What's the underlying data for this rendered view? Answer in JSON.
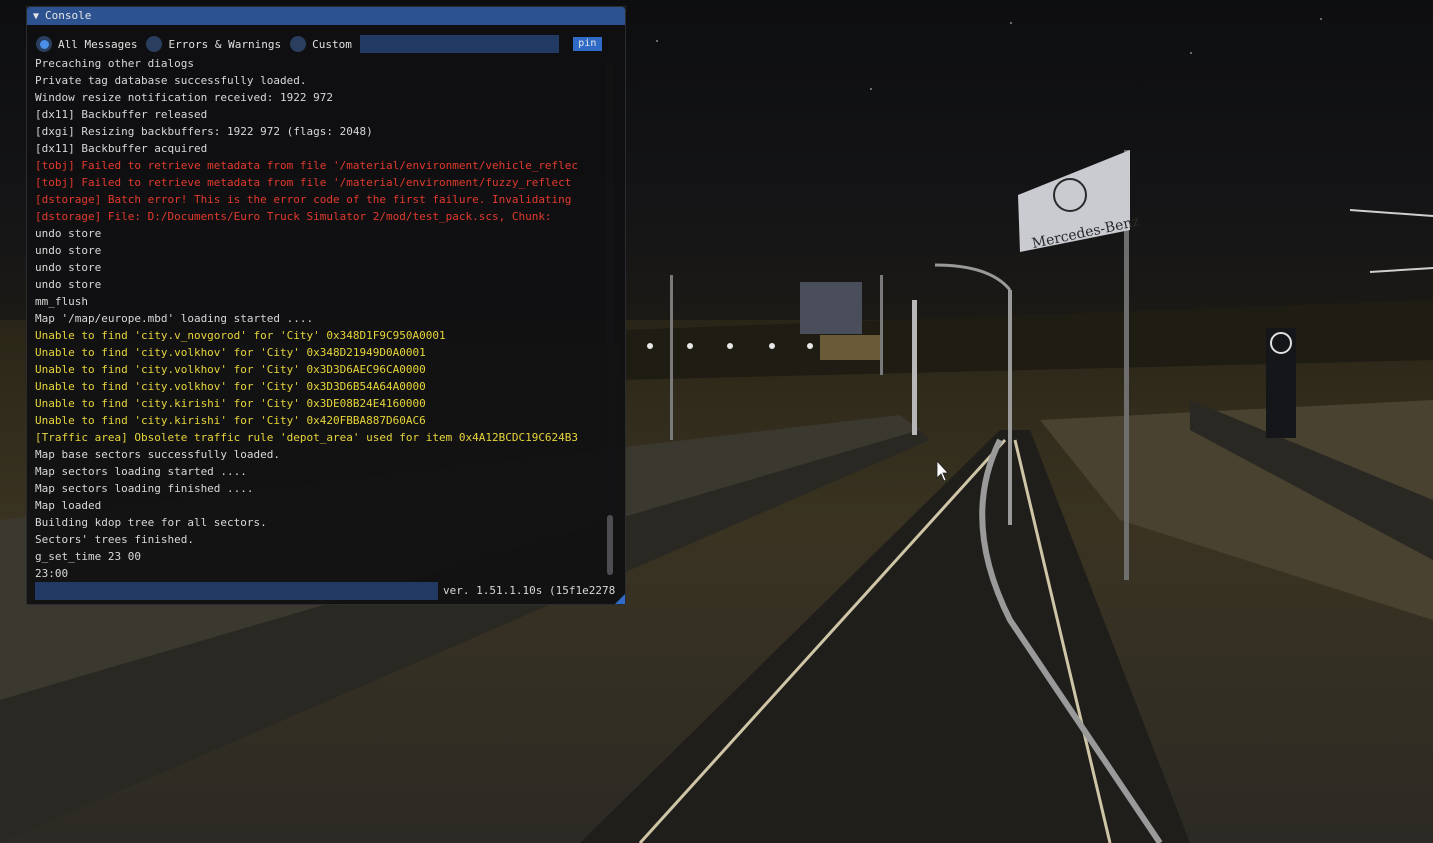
{
  "console": {
    "title": "Console",
    "filters": {
      "all_messages": "All Messages",
      "errors_warnings": "Errors & Warnings",
      "custom": "Custom",
      "selected": "All Messages"
    },
    "filter_input_value": "",
    "pin_label": "pin",
    "log_lines": [
      {
        "text": "Precaching other dialogs",
        "level": "info"
      },
      {
        "text": "Private tag database successfully loaded.",
        "level": "info"
      },
      {
        "text": "Window resize notification received: 1922 972",
        "level": "info"
      },
      {
        "text": "[dx11] Backbuffer released",
        "level": "info"
      },
      {
        "text": "[dxgi] Resizing backbuffers: 1922 972 (flags: 2048)",
        "level": "info"
      },
      {
        "text": "[dx11] Backbuffer acquired",
        "level": "info"
      },
      {
        "text": "[tobj] Failed to retrieve metadata from file '/material/environment/vehicle_reflec",
        "level": "error"
      },
      {
        "text": "[tobj] Failed to retrieve metadata from file '/material/environment/fuzzy_reflect",
        "level": "error"
      },
      {
        "text": "[dstorage] Batch error! This is the error code of the first failure. Invalidating",
        "level": "error"
      },
      {
        "text": "[dstorage] File: D:/Documents/Euro Truck Simulator 2/mod/test_pack.scs, Chunk:",
        "level": "error"
      },
      {
        "text": "undo store",
        "level": "info"
      },
      {
        "text": "undo store",
        "level": "info"
      },
      {
        "text": "undo store",
        "level": "info"
      },
      {
        "text": "undo store",
        "level": "info"
      },
      {
        "text": "mm_flush",
        "level": "info"
      },
      {
        "text": "Map '/map/europe.mbd' loading started ....",
        "level": "info"
      },
      {
        "text": "Unable to find 'city.v_novgorod' for 'City' 0x348D1F9C950A0001",
        "level": "warn"
      },
      {
        "text": "Unable to find 'city.volkhov' for 'City' 0x348D21949D0A0001",
        "level": "warn"
      },
      {
        "text": "Unable to find 'city.volkhov' for 'City' 0x3D3D6AEC96CA0000",
        "level": "warn"
      },
      {
        "text": "Unable to find 'city.volkhov' for 'City' 0x3D3D6B54A64A0000",
        "level": "warn"
      },
      {
        "text": "Unable to find 'city.kirishi' for 'City' 0x3DE08B24E4160000",
        "level": "warn"
      },
      {
        "text": "Unable to find 'city.kirishi' for 'City' 0x420FBBA887D60AC6",
        "level": "warn"
      },
      {
        "text": "[Traffic area] Obsolete traffic rule 'depot_area' used for item 0x4A12BCDC19C624B3",
        "level": "warn"
      },
      {
        "text": "Map base sectors successfully loaded.",
        "level": "info"
      },
      {
        "text": "Map sectors loading started ....",
        "level": "info"
      },
      {
        "text": "Map sectors loading finished ....",
        "level": "info"
      },
      {
        "text": "Map loaded",
        "level": "info"
      },
      {
        "text": "Building kdop tree for all sectors.",
        "level": "info"
      },
      {
        "text": "Sectors' trees finished.",
        "level": "info"
      },
      {
        "text": "g_set_time 23 00",
        "level": "info"
      },
      {
        "text": "23:00",
        "level": "info"
      }
    ],
    "command_input_value": "",
    "version": "ver. 1.51.1.10s (15f1e2278"
  },
  "scene": {
    "sign_text": "Mercedes-Benz"
  },
  "colors": {
    "title_bar": "#2d5290",
    "input_bg": "#223a63",
    "error_text": "#e23a2c",
    "warning_text": "#e6d53a",
    "info_text": "#d8d8d8"
  }
}
